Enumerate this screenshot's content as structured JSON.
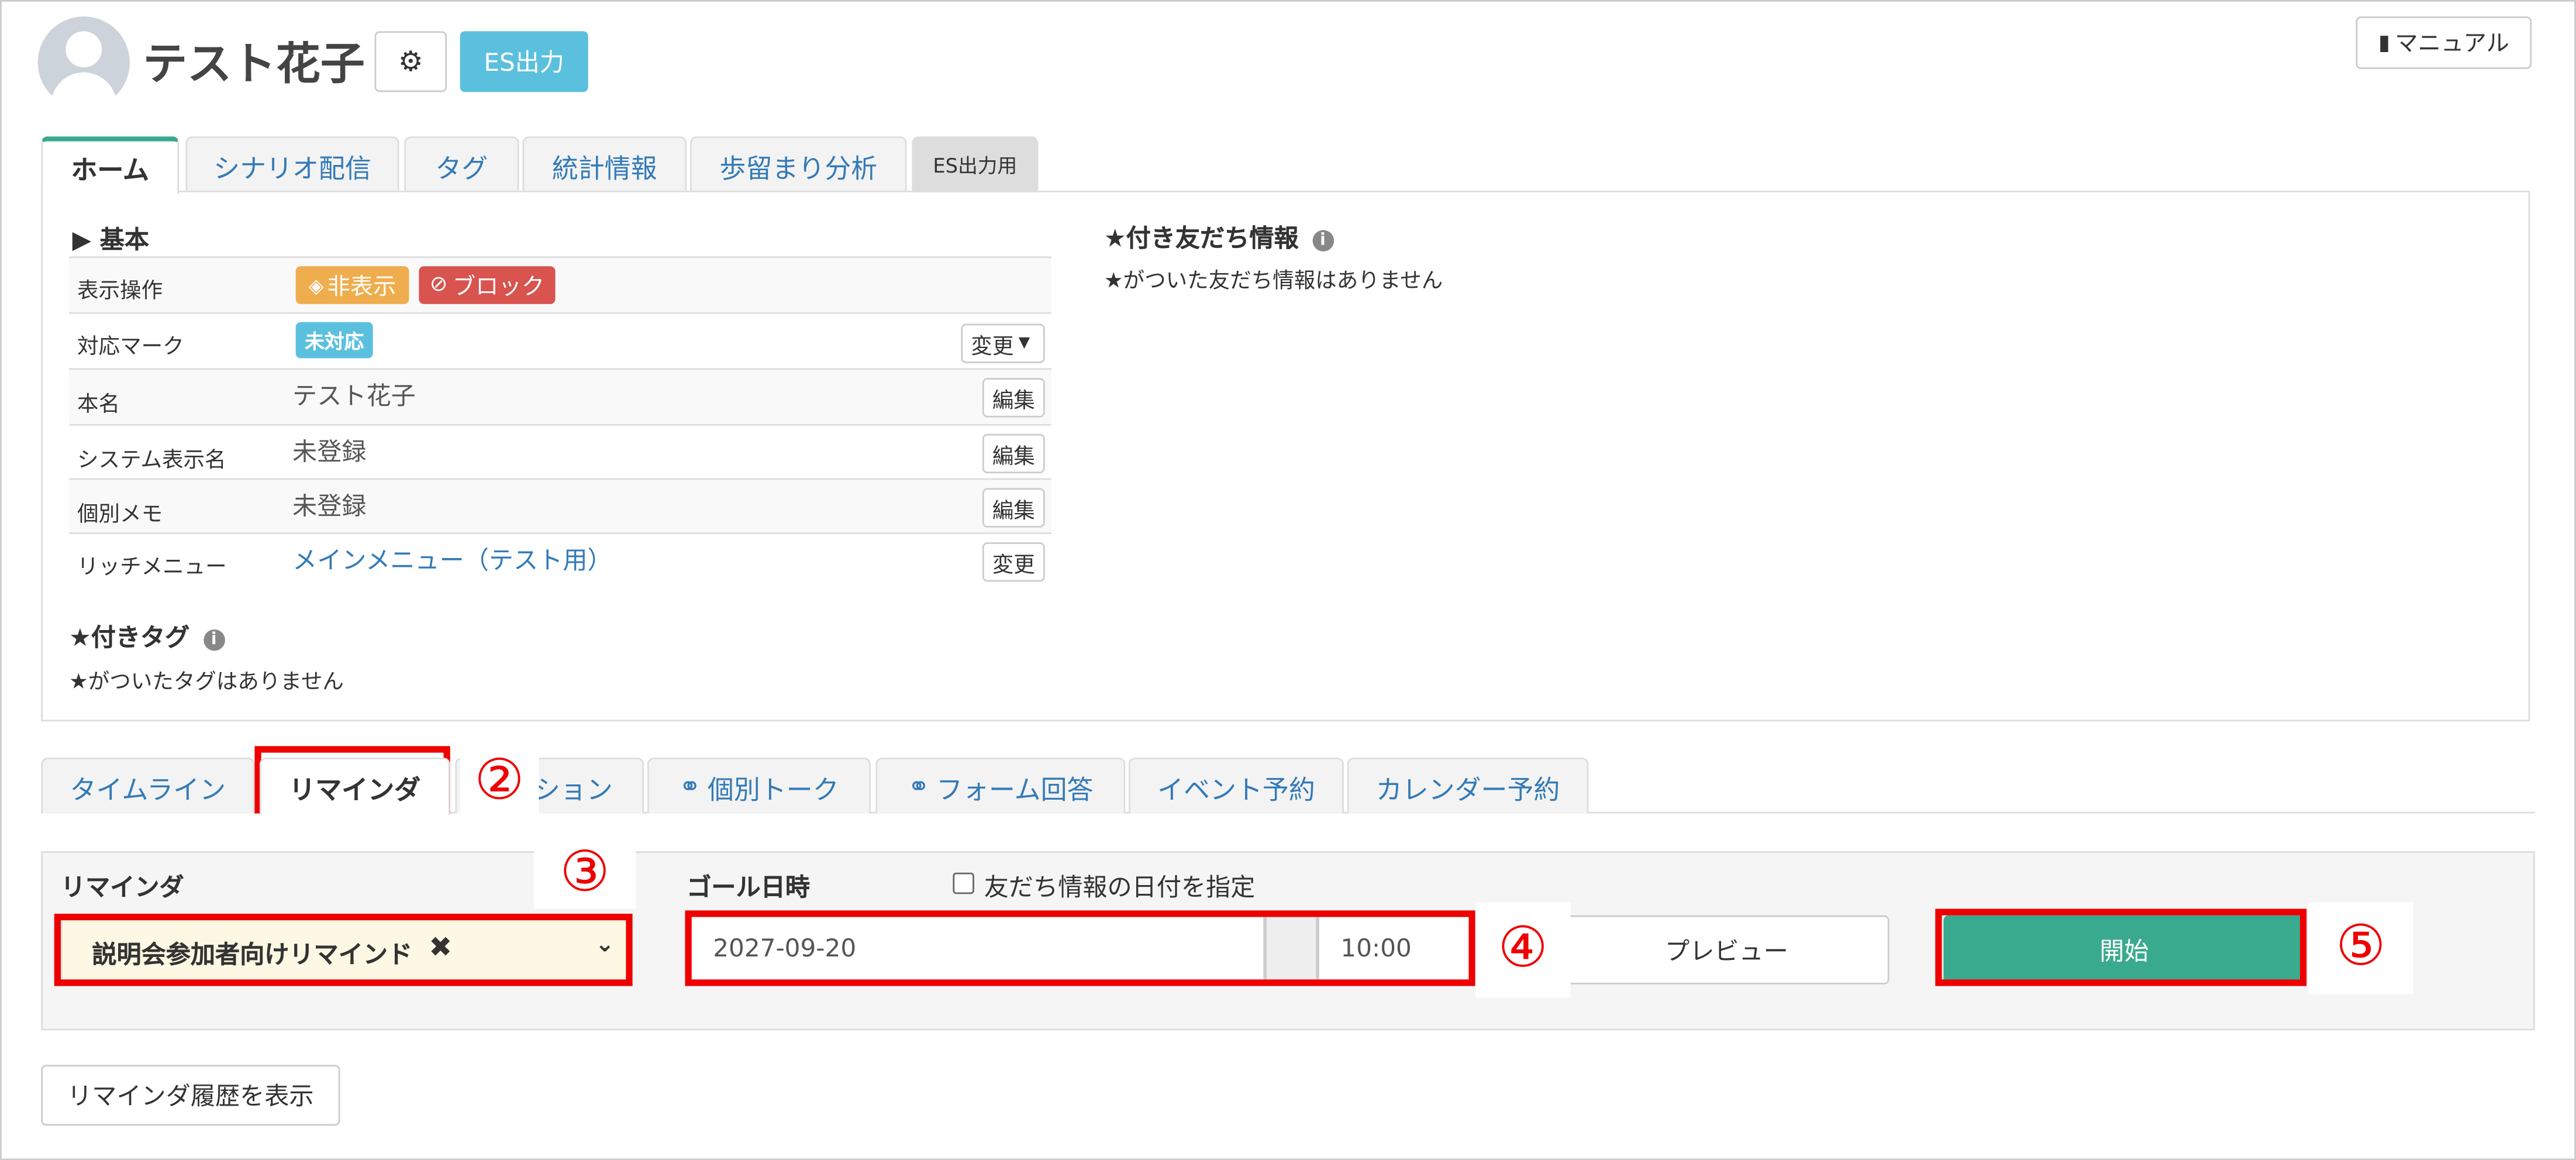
{
  "header": {
    "user_name": "テスト花子",
    "es_button": "ES出力",
    "manual_button": "マニュアル"
  },
  "main_tabs": [
    {
      "label": "ホーム",
      "active": true
    },
    {
      "label": "シナリオ配信"
    },
    {
      "label": "タグ"
    },
    {
      "label": "統計情報"
    },
    {
      "label": "歩留まり分析"
    },
    {
      "label": "ES出力用"
    }
  ],
  "basic": {
    "heading": "▶ 基本",
    "rows": [
      {
        "label": "表示操作"
      },
      {
        "label": "対応マーク"
      },
      {
        "label": "本名",
        "value": "テスト花子",
        "button": "編集"
      },
      {
        "label": "システム表示名",
        "value": "未登録",
        "button": "編集"
      },
      {
        "label": "個別メモ",
        "value": "未登録",
        "button": "編集"
      },
      {
        "label": "リッチメニュー",
        "value": "メインメニュー（テスト用）",
        "button": "変更"
      }
    ],
    "hide_button": "非表示",
    "block_button": "ブロック",
    "status_badge": "未対応",
    "change_dropdown": "変更"
  },
  "star_tags": {
    "heading": "★付きタグ",
    "empty": "★がついたタグはありません"
  },
  "star_friend": {
    "heading": "★付き友だち情報",
    "empty": "★がついた友だち情報はありません"
  },
  "sub_tabs": [
    {
      "label": "タイムライン"
    },
    {
      "label": "リマインダ",
      "active": true
    },
    {
      "label": "ション"
    },
    {
      "label": "個別トーク"
    },
    {
      "label": "フォーム回答"
    },
    {
      "label": "イベント予約"
    },
    {
      "label": "カレンダー予約"
    }
  ],
  "reminder": {
    "section_label": "リマインダ",
    "selected": "説明会参加者向けリマインド",
    "goal_label": "ゴール日時",
    "checkbox_label": "友だち情報の日付を指定",
    "date": "2027-09-20",
    "time": "10:00",
    "preview_button": "プレビュー",
    "start_button": "開始",
    "history_button": "リマインダ履歴を表示"
  },
  "annotations": [
    "②",
    "③",
    "④",
    "⑤"
  ],
  "colors": {
    "accent_blue": "#5bc0de",
    "start_green": "#3aaa8f",
    "annotation_red": "#e00000",
    "hide_orange": "#f0ad4e",
    "block_red": "#d9534f"
  }
}
